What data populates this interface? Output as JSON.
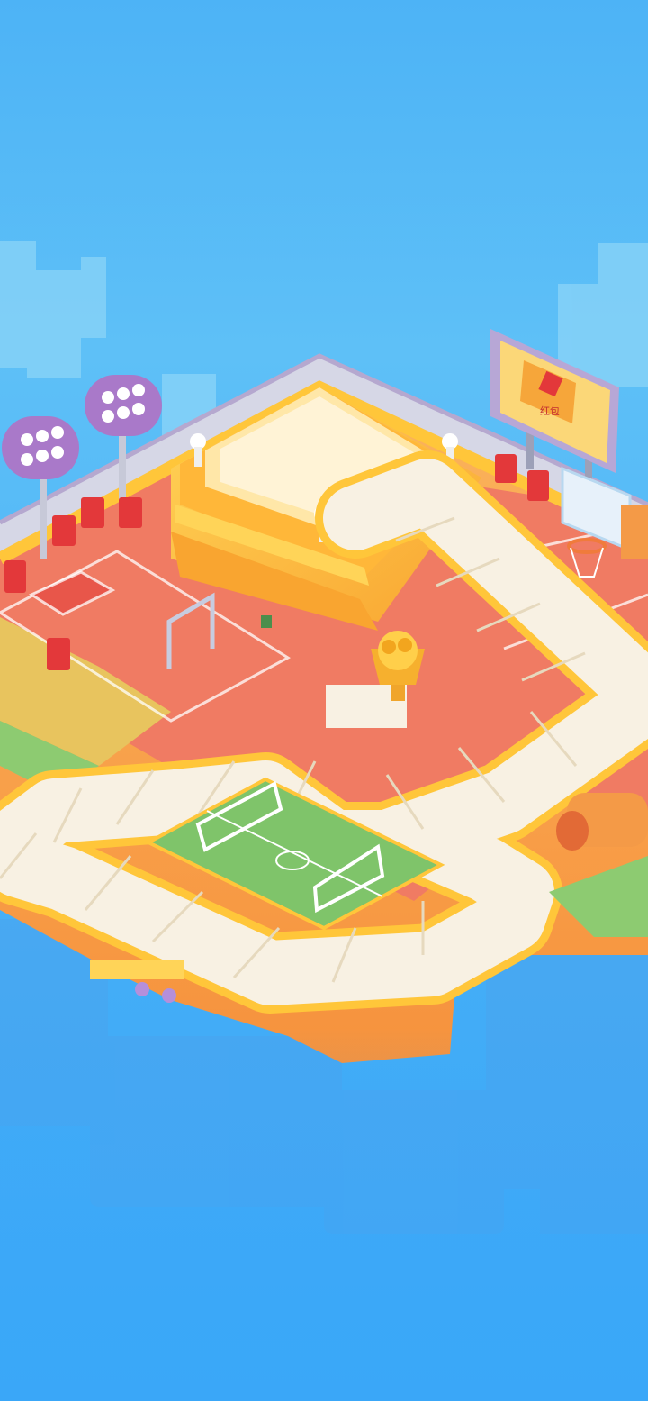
{
  "screen": {
    "name": "board-game-stadium-scene"
  },
  "palette": {
    "sky_top": "#4DB3F6",
    "sky_bottom": "#3AA7F8",
    "board_orange": "#F9A24B",
    "board_yellow": "#FFC63A",
    "court_red": "#F07B63",
    "path_tile": "#F8F1E3",
    "field_green": "#7FC46A",
    "sand": "#E8C45E",
    "light_purple": "#A979C9",
    "red_packet": "#E3383A"
  },
  "icons": [
    "stadium-light-icon",
    "red-packet-character-icon",
    "trophy-coins-icon",
    "billboard-icon",
    "basketball-hoop-icon",
    "soccer-goal-icon",
    "pull-up-bar-icon"
  ],
  "billboard": {
    "label": "红包"
  }
}
